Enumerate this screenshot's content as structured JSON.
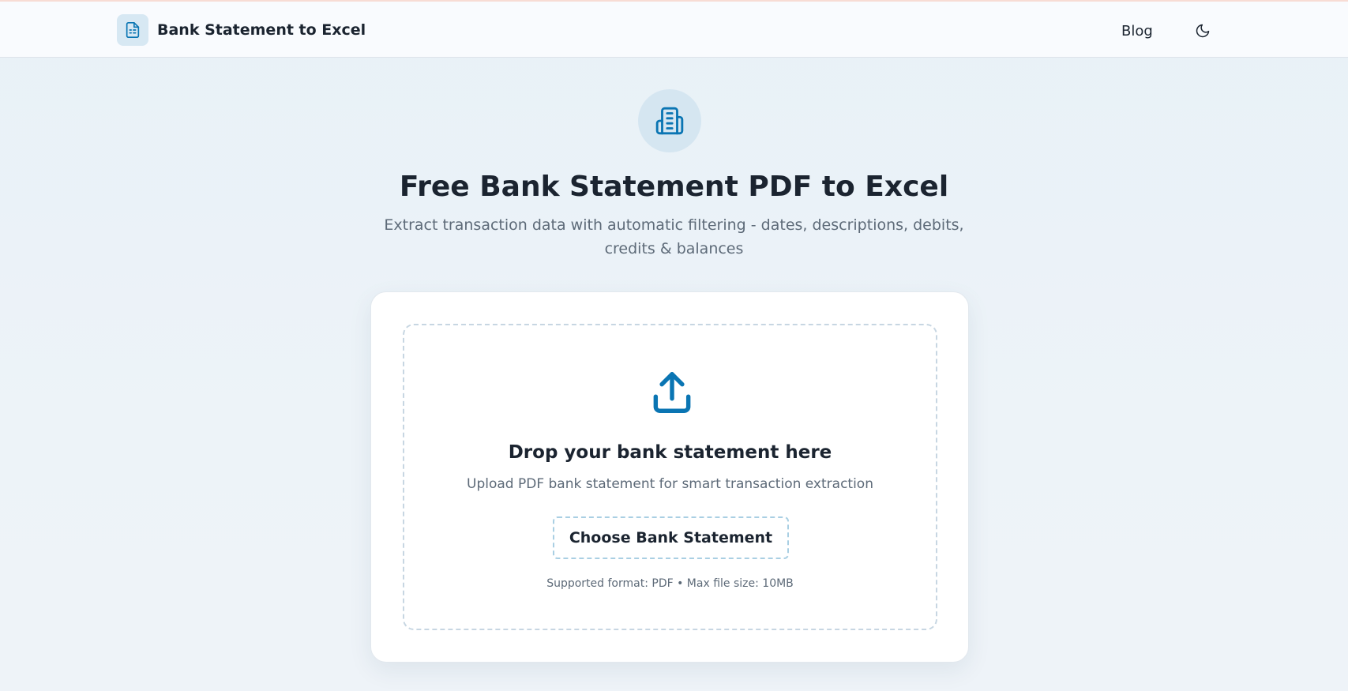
{
  "header": {
    "brand_icon": "document-icon",
    "brand_title": "Bank Statement to Excel",
    "nav": [
      {
        "label": "Blog"
      }
    ],
    "theme_toggle_icon": "moon-icon"
  },
  "hero": {
    "icon": "bank-building-icon",
    "title": "Free Bank Statement PDF to Excel",
    "subtitle": "Extract transaction data with automatic filtering - dates, descriptions, debits, credits & balances"
  },
  "upload": {
    "icon": "upload-icon",
    "title": "Drop your bank statement here",
    "subtitle": "Upload PDF bank statement for smart transaction extraction",
    "button_label": "Choose Bank Statement",
    "supported_text": "Supported format: PDF • Max file size: 10MB"
  },
  "colors": {
    "accent": "#0a75b3",
    "icon_bg": "#d5e6f1",
    "text_primary": "#1b2430",
    "text_muted": "#5d6a78"
  }
}
